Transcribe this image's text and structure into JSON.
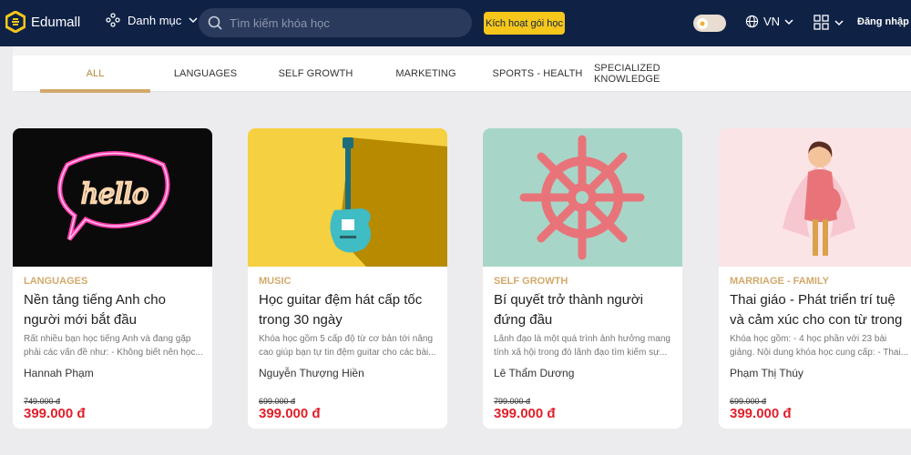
{
  "header": {
    "logo_text": "Edumall",
    "category_label": "Danh mục",
    "search_placeholder": "Tìm kiếm khóa học",
    "activate_label": "Kích hoạt gói học",
    "language": "VN",
    "login_label": "Đăng nhập"
  },
  "tabs": [
    {
      "label": "ALL"
    },
    {
      "label": "LANGUAGES"
    },
    {
      "label": "SELF GROWTH"
    },
    {
      "label": "MARKETING"
    },
    {
      "label": "SPORTS - HEALTH"
    },
    {
      "label": "SPECIALIZED KNOWLEDGE"
    }
  ],
  "courses": [
    {
      "category": "LANGUAGES",
      "title": "Nền tảng tiếng Anh cho người mới bắt đầu",
      "description": "Rất nhiều bạn học tiếng Anh và đang gặp phải các vấn đề như: - Không biết nên học...",
      "author": "Hannah Phạm",
      "old_price": "749.000 đ",
      "price": "399.000 đ"
    },
    {
      "category": "MUSIC",
      "title": "Học guitar đệm hát cấp tốc trong 30 ngày",
      "description": "Khóa học gồm 5 cấp độ từ cơ bản tới nâng cao giúp bạn tự tin đệm guitar cho các bài...",
      "author": "Nguyễn Thượng Hiền",
      "old_price": "699.000 đ",
      "price": "399.000 đ"
    },
    {
      "category": "SELF GROWTH",
      "title": "Bí quyết trở thành người đứng đầu",
      "description": "Lãnh đạo là một quá trình ảnh hưởng mang tính xã hội trong đó lãnh đạo tìm kiếm sự...",
      "author": "Lê Thẩm Dương",
      "old_price": "799.000 đ",
      "price": "399.000 đ"
    },
    {
      "category": "MARRIAGE - FAMILY",
      "title": "Thai giáo - Phát triển trí tuệ và cảm xúc cho con từ trong bụ...",
      "description": "Khóa học gồm: - 4 học phần với 23 bài giảng. Nội dung khóa học cung cấp: - Thai...",
      "author": "Phạm Thị Thúy",
      "old_price": "699.000 đ",
      "price": "399.000 đ"
    }
  ]
}
